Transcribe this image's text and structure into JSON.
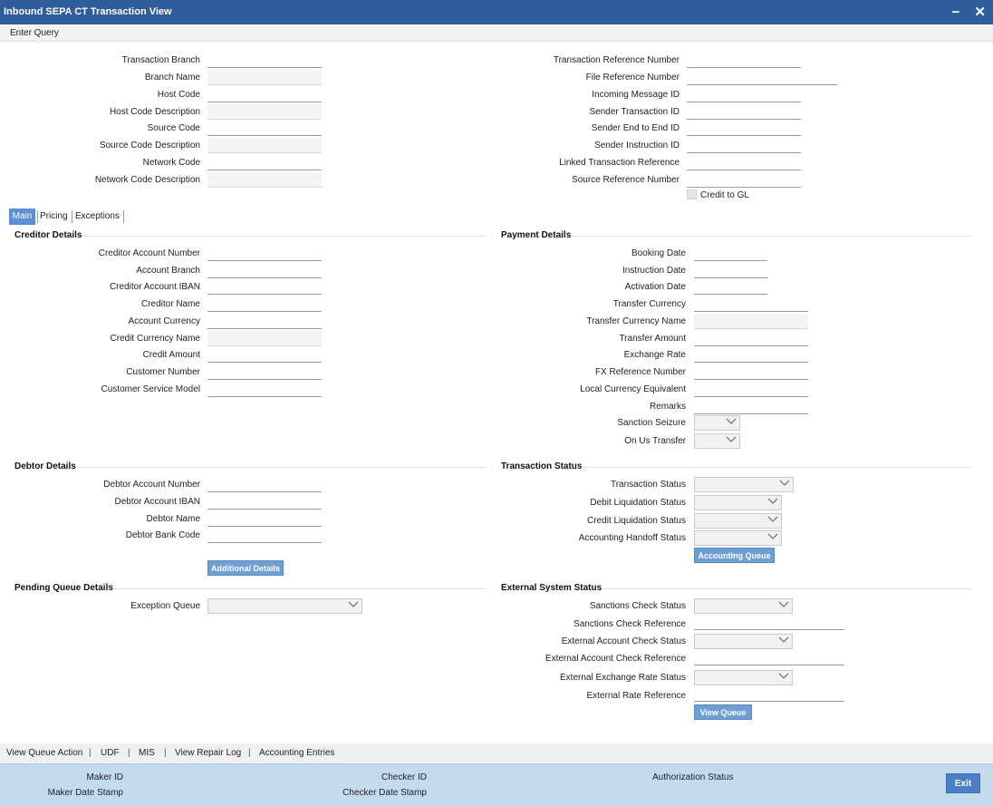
{
  "window": {
    "title": "Inbound SEPA CT Transaction View",
    "minimize": "−",
    "close": "✕"
  },
  "menu": {
    "enter_query": "Enter Query"
  },
  "header_left": [
    {
      "label": "Transaction Branch",
      "value": ""
    },
    {
      "label": "Branch Name",
      "value": ""
    },
    {
      "label": "Host Code",
      "value": ""
    },
    {
      "label": "Host Code Description",
      "value": ""
    },
    {
      "label": "Source Code",
      "value": ""
    },
    {
      "label": "Source Code Description",
      "value": ""
    },
    {
      "label": "Network Code",
      "value": ""
    },
    {
      "label": "Network Code Description",
      "value": ""
    }
  ],
  "header_right": [
    {
      "label": "Transaction Reference Number",
      "value": ""
    },
    {
      "label": "File Reference Number",
      "value": ""
    },
    {
      "label": "Incoming Message ID",
      "value": ""
    },
    {
      "label": "Sender Transaction ID",
      "value": ""
    },
    {
      "label": "Sender End to End ID",
      "value": ""
    },
    {
      "label": "Sender Instruction ID",
      "value": ""
    },
    {
      "label": "Linked Transaction Reference",
      "value": ""
    },
    {
      "label": "Source Reference Number",
      "value": ""
    }
  ],
  "credit_to_gl": {
    "label": "Credit to GL",
    "checked": false
  },
  "tabs": [
    {
      "label": "Main",
      "active": true
    },
    {
      "label": "Pricing",
      "active": false
    },
    {
      "label": "Exceptions",
      "active": false
    }
  ],
  "creditor": {
    "title": "Creditor Details",
    "fields": [
      {
        "label": "Creditor Account Number",
        "value": ""
      },
      {
        "label": "Account Branch",
        "value": ""
      },
      {
        "label": "Creditor Account IBAN",
        "value": ""
      },
      {
        "label": "Creditor Name",
        "value": ""
      },
      {
        "label": "Account Currency",
        "value": ""
      },
      {
        "label": "Credit Currency Name",
        "value": ""
      },
      {
        "label": "Credit Amount",
        "value": ""
      },
      {
        "label": "Customer Number",
        "value": ""
      },
      {
        "label": "Customer Service Model",
        "value": ""
      }
    ]
  },
  "payment": {
    "title": "Payment Details",
    "fields": [
      {
        "label": "Booking Date",
        "value": ""
      },
      {
        "label": "Instruction Date",
        "value": ""
      },
      {
        "label": "Activation Date",
        "value": ""
      },
      {
        "label": "Transfer Currency",
        "value": ""
      },
      {
        "label": "Transfer Currency Name",
        "value": ""
      },
      {
        "label": "Transfer Amount",
        "value": ""
      },
      {
        "label": "Exchange Rate",
        "value": ""
      },
      {
        "label": "FX Reference Number",
        "value": ""
      },
      {
        "label": "Local Currency Equivalent",
        "value": ""
      },
      {
        "label": "Remarks",
        "value": ""
      },
      {
        "label": "Sanction Seizure",
        "value": ""
      },
      {
        "label": "On Us Transfer",
        "value": ""
      }
    ]
  },
  "debtor": {
    "title": "Debtor Details",
    "fields": [
      {
        "label": "Debtor Account Number",
        "value": ""
      },
      {
        "label": "Debtor Account IBAN",
        "value": ""
      },
      {
        "label": "Debtor Name",
        "value": ""
      },
      {
        "label": "Debtor Bank Code",
        "value": ""
      }
    ],
    "button": "Additional Details"
  },
  "txn_status": {
    "title": "Transaction Status",
    "fields": [
      {
        "label": "Transaction Status",
        "value": ""
      },
      {
        "label": "Debit Liquidation Status",
        "value": ""
      },
      {
        "label": "Credit Liquidation Status",
        "value": ""
      },
      {
        "label": "Accounting Handoff Status",
        "value": ""
      }
    ],
    "button": "Accounting Queue"
  },
  "pending": {
    "title": "Pending Queue Details",
    "fields": [
      {
        "label": "Exception Queue",
        "value": ""
      }
    ]
  },
  "external": {
    "title": "External System Status",
    "fields": [
      {
        "label": "Sanctions Check Status",
        "value": ""
      },
      {
        "label": "Sanctions Check Reference",
        "value": ""
      },
      {
        "label": "External Account Check Status",
        "value": ""
      },
      {
        "label": "External Account Check Reference",
        "value": ""
      },
      {
        "label": "External Exchange Rate Status",
        "value": ""
      },
      {
        "label": "External Rate Reference",
        "value": ""
      }
    ],
    "button": "View Queue"
  },
  "bottom_links": [
    "View Queue Action",
    "|",
    "UDF",
    "|",
    "MIS",
    "|",
    "View Repair Log",
    "|",
    "Accounting Entries"
  ],
  "footer": {
    "maker_id": "Maker ID",
    "maker_date": "Maker Date Stamp",
    "checker_id": "Checker ID",
    "checker_date": "Checker Date Stamp",
    "auth_status": "Authorization Status",
    "exit": "Exit"
  }
}
